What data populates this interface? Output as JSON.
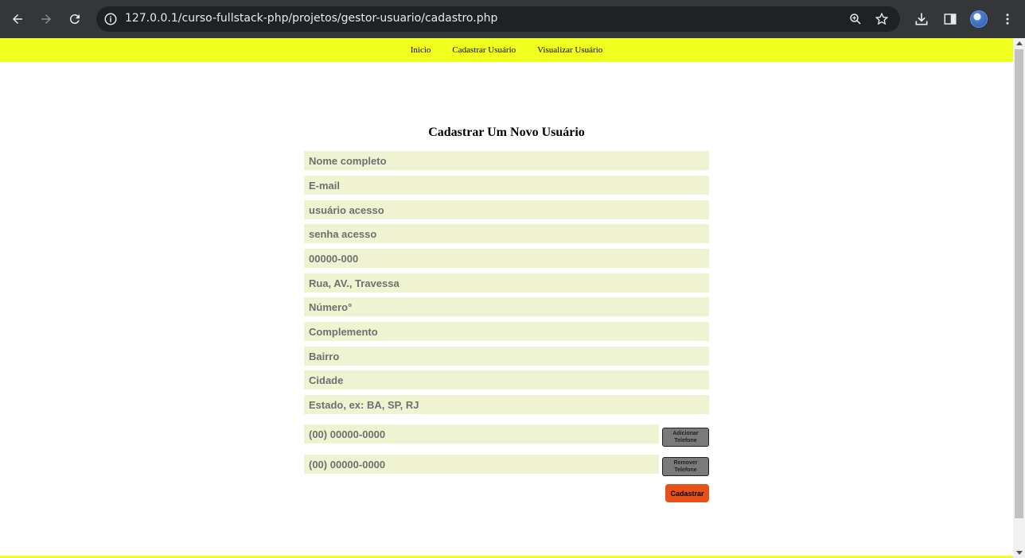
{
  "browser": {
    "url": "127.0.0.1/curso-fullstack-php/projetos/gestor-usuario/cadastro.php",
    "icons": {
      "back": "arrow-left-icon",
      "forward": "arrow-right-icon",
      "reload": "reload-icon",
      "site_info": "info-icon",
      "zoom": "zoom-icon",
      "bookmark": "star-icon",
      "download": "download-icon",
      "side_panel": "side-panel-icon",
      "menu": "kebab-menu-icon"
    }
  },
  "nav": {
    "items": [
      {
        "label": "Inicio"
      },
      {
        "label": "Cadastrar Usuário"
      },
      {
        "label": "Visualizar Usuário"
      }
    ],
    "bg_color": "#f0ff1e"
  },
  "form": {
    "title": "Cadastrar Um Novo Usuário",
    "fields": {
      "nome": {
        "placeholder": "Nome completo"
      },
      "email": {
        "placeholder": "E-mail"
      },
      "usuario": {
        "placeholder": "usuário acesso"
      },
      "senha": {
        "placeholder": "senha acesso"
      },
      "cep": {
        "placeholder": "00000-000"
      },
      "rua": {
        "placeholder": "Rua, AV., Travessa"
      },
      "numero": {
        "placeholder": "Número°"
      },
      "complemento": {
        "placeholder": "Complemento"
      },
      "bairro": {
        "placeholder": "Bairro"
      },
      "cidade": {
        "placeholder": "Cidade"
      },
      "estado": {
        "placeholder": "Estado, ex: BA, SP, RJ"
      },
      "telefone1": {
        "placeholder": "(00) 00000-0000"
      },
      "telefone2": {
        "placeholder": "(00) 00000-0000"
      }
    },
    "add_phone_label": "Adicionar Telefone",
    "remove_phone_label": "Remover Telefone",
    "submit_label": "Cadastrar",
    "field_bg_color": "#eff3d2",
    "submit_color": "#e8501a"
  }
}
